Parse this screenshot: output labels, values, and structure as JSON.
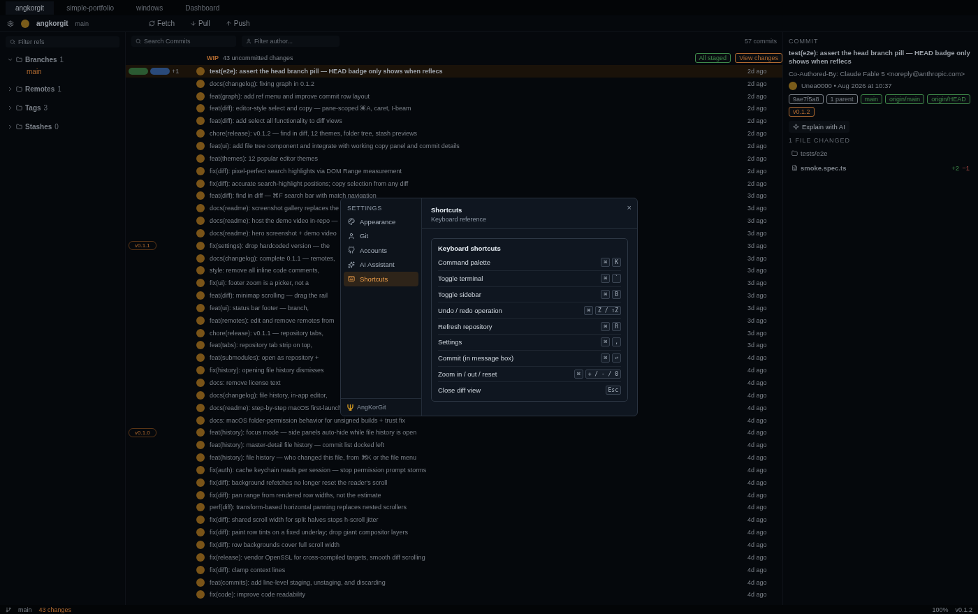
{
  "repo_tabs": [
    {
      "label": "angkorgit",
      "selected": true
    },
    {
      "label": "simple-portfolio",
      "selected": false
    },
    {
      "label": "windows",
      "selected": false
    },
    {
      "label": "Dashboard",
      "selected": false
    }
  ],
  "toolbar": {
    "repo_name": "angkorgit",
    "repo_branch": "main",
    "actions": [
      {
        "kind": "fetch",
        "label": "Fetch"
      },
      {
        "kind": "pull",
        "label": "Pull"
      },
      {
        "kind": "push",
        "label": "Push"
      }
    ]
  },
  "sidebar": {
    "filter_placeholder": "Filter refs",
    "sections": [
      {
        "label": "Branches",
        "count": "1",
        "expanded": true,
        "children": [
          {
            "label": "main",
            "selected": true
          }
        ]
      },
      {
        "label": "Remotes",
        "count": "1",
        "expanded": false
      },
      {
        "label": "Tags",
        "count": "3",
        "expanded": false
      },
      {
        "label": "Stashes",
        "count": "0",
        "expanded": false
      }
    ]
  },
  "commit_list": {
    "search_placeholder": "Search Commits",
    "author_placeholder": "Filter author...",
    "count": "57 commits",
    "wip": {
      "label": "WIP",
      "summary": "43 uncommitted changes"
    },
    "wip_badges": [
      {
        "label": "All staged",
        "color": "#3f8a4a"
      },
      {
        "label": "View changes",
        "color": "#b06a30"
      }
    ],
    "rows": [
      {
        "message": "test(e2e): assert the head branch pill — HEAD badge only shows when reflecs",
        "time": "2d ago",
        "selected": true,
        "refs": [
          {
            "color": "#2b5a32"
          },
          {
            "color": "#2a4a7a"
          }
        ],
        "more": "+1"
      },
      {
        "message": "docs(changelog): fixing graph in 0.1.2",
        "time": "2d ago",
        "selected": false
      },
      {
        "message": "feat(graph): add ref menu and improve commit row layout",
        "time": "2d ago",
        "selected": false
      },
      {
        "message": "feat(diff): editor-style select and copy — pane-scoped ⌘A, caret, I-beam",
        "time": "2d ago",
        "selected": false
      },
      {
        "message": "feat(diff): add select all functionality to diff views",
        "time": "2d ago",
        "selected": false
      },
      {
        "message": "chore(release): v0.1.2 — find in diff, 12 themes, folder tree, stash previews",
        "time": "2d ago",
        "selected": false
      },
      {
        "message": "feat(ui): add file tree component and integrate with working copy panel and commit details",
        "time": "2d ago",
        "selected": false
      },
      {
        "message": "feat(themes): 12 popular editor themes",
        "time": "2d ago",
        "selected": false
      },
      {
        "message": "fix(diff): pixel-perfect search highlights via DOM Range measurement",
        "time": "2d ago",
        "selected": false
      },
      {
        "message": "fix(diff): accurate search-highlight positions; copy selection from any diff",
        "time": "2d ago",
        "selected": false
      },
      {
        "message": "feat(diff): find in diff — ⌘F search bar with match navigation",
        "time": "3d ago",
        "selected": false
      },
      {
        "message": "docs(readme): screenshot gallery replaces the",
        "time": "3d ago",
        "selected": false
      },
      {
        "message": "docs(readme): host the demo video in-repo —",
        "time": "3d ago",
        "selected": false
      },
      {
        "message": "docs(readme): hero screenshot + demo video",
        "time": "3d ago",
        "selected": false
      },
      {
        "message": "fix(settings): drop hardcoded version — the",
        "time": "3d ago",
        "selected": false,
        "tag": "v0.1.1"
      },
      {
        "message": "docs(changelog): complete 0.1.1 — remotes,",
        "time": "3d ago",
        "selected": false
      },
      {
        "message": "style: remove all inline code comments,",
        "time": "3d ago",
        "selected": false
      },
      {
        "message": "fix(ui): footer zoom is a picker, not a",
        "time": "3d ago",
        "selected": false
      },
      {
        "message": "feat(diff): minimap scrolling — drag the rail",
        "time": "3d ago",
        "selected": false
      },
      {
        "message": "feat(ui): status bar footer — branch,",
        "time": "3d ago",
        "selected": false
      },
      {
        "message": "feat(remotes): edit and remove remotes from",
        "time": "3d ago",
        "selected": false
      },
      {
        "message": "chore(release): v0.1.1 — repository tabs,",
        "time": "3d ago",
        "selected": false
      },
      {
        "message": "feat(tabs): repository tab strip on top,",
        "time": "3d ago",
        "selected": false
      },
      {
        "message": "feat(submodules): open as repository +",
        "time": "4d ago",
        "selected": false
      },
      {
        "message": "fix(history): opening file history dismisses",
        "time": "4d ago",
        "selected": false
      },
      {
        "message": "docs: remove license text",
        "time": "4d ago",
        "selected": false
      },
      {
        "message": "docs(changelog): file history, in-app editor,",
        "time": "4d ago",
        "selected": false
      },
      {
        "message": "docs(readme): step-by-step macOS first-launch",
        "time": "4d ago",
        "selected": false
      },
      {
        "message": "docs: macOS folder-permission behavior for unsigned builds + trust fix",
        "time": "4d ago",
        "selected": false
      },
      {
        "message": "feat(history): focus mode — side panels auto-hide while file history is open",
        "time": "4d ago",
        "selected": false,
        "tag": "v0.1.0"
      },
      {
        "message": "feat(history): master-detail file history — commit list docked left",
        "time": "4d ago",
        "selected": false
      },
      {
        "message": "feat(history): file history — who changed this file, from ⌘K or the file menu",
        "time": "4d ago",
        "selected": false
      },
      {
        "message": "fix(auth): cache keychain reads per session — stop permission prompt storms",
        "time": "4d ago",
        "selected": false
      },
      {
        "message": "fix(diff): background refetches no longer reset the reader's scroll",
        "time": "4d ago",
        "selected": false
      },
      {
        "message": "fix(diff): pan range from rendered row widths, not the estimate",
        "time": "4d ago",
        "selected": false
      },
      {
        "message": "perf(diff): transform-based horizontal panning replaces nested scrollers",
        "time": "4d ago",
        "selected": false
      },
      {
        "message": "fix(diff): shared scroll width for split halves stops h-scroll jitter",
        "time": "4d ago",
        "selected": false
      },
      {
        "message": "fix(diff): paint row tints on a fixed underlay; drop giant compositor layers",
        "time": "4d ago",
        "selected": false
      },
      {
        "message": "fix(diff): row backgrounds cover full scroll width",
        "time": "4d ago",
        "selected": false
      },
      {
        "message": "fix(release): vendor OpenSSL for cross-compiled targets, smooth diff scrolling",
        "time": "4d ago",
        "selected": false
      },
      {
        "message": "fix(diff): clamp context lines",
        "time": "4d ago",
        "selected": false
      },
      {
        "message": "feat(commits): add line-level staging, unstaging, and discarding",
        "time": "4d ago",
        "selected": false
      },
      {
        "message": "fix(code): improve code readability",
        "time": "4d ago",
        "selected": false
      }
    ]
  },
  "commit_panel": {
    "heading": "COMMIT",
    "message": "test(e2e): assert the head branch pill — HEAD badge only shows when reflecs",
    "trailer": "Co-Authored-By: Claude Fable 5 <noreply@anthropic.com>",
    "author": "Unea0000 • Aug 2026 at 10:37",
    "refs": [
      {
        "label": "9ae7f5a8",
        "color": "#7a8088"
      },
      {
        "label": "1 parent",
        "color": "#7a8088"
      },
      {
        "label": "main",
        "color": "#3f8a4a"
      },
      {
        "label": "origin/main",
        "color": "#3f8a4a"
      },
      {
        "label": "origin/HEAD",
        "color": "#3f8a4a"
      },
      {
        "label": "v0.1.2",
        "color": "#b06a30"
      }
    ],
    "explain": "Explain with AI",
    "files_heading": "1 FILE CHANGED",
    "folder": "tests/e2e",
    "file": "smoke.spec.ts",
    "added": "+2",
    "removed": "−1"
  },
  "status_bar": {
    "branch": "main",
    "changes": "43 changes",
    "zoom": "100%",
    "version": "v0.1.2"
  },
  "settings_dialog": {
    "nav_heading": "SETTINGS",
    "nav": [
      {
        "kind": "appearance",
        "label": "Appearance",
        "selected": false
      },
      {
        "kind": "git",
        "label": "Git",
        "selected": false
      },
      {
        "kind": "accounts",
        "label": "Accounts",
        "selected": false
      },
      {
        "kind": "ai",
        "label": "AI Assistant",
        "selected": false
      },
      {
        "kind": "shortcuts",
        "label": "Shortcuts",
        "selected": true
      }
    ],
    "footer": "AngKorGit",
    "title": "Shortcuts",
    "subtitle": "Keyboard reference",
    "close": "×",
    "card_title": "Keyboard shortcuts",
    "shortcuts": [
      {
        "action": "Command palette",
        "keys": [
          "⌘",
          "K"
        ]
      },
      {
        "action": "Toggle terminal",
        "keys": [
          "⌘",
          "`"
        ]
      },
      {
        "action": "Toggle sidebar",
        "keys": [
          "⌘",
          "B"
        ]
      },
      {
        "action": "Undo / redo operation",
        "keys": [
          "⌘",
          "Z / ⇧Z"
        ]
      },
      {
        "action": "Refresh repository",
        "keys": [
          "⌘",
          "R"
        ]
      },
      {
        "action": "Settings",
        "keys": [
          "⌘",
          ","
        ]
      },
      {
        "action": "Commit (in message box)",
        "keys": [
          "⌘",
          "↩"
        ]
      },
      {
        "action": "Zoom in / out / reset",
        "keys": [
          "⌘",
          "+ / - / 0"
        ]
      },
      {
        "action": "Close diff view",
        "keys": [
          "Esc"
        ]
      }
    ]
  }
}
